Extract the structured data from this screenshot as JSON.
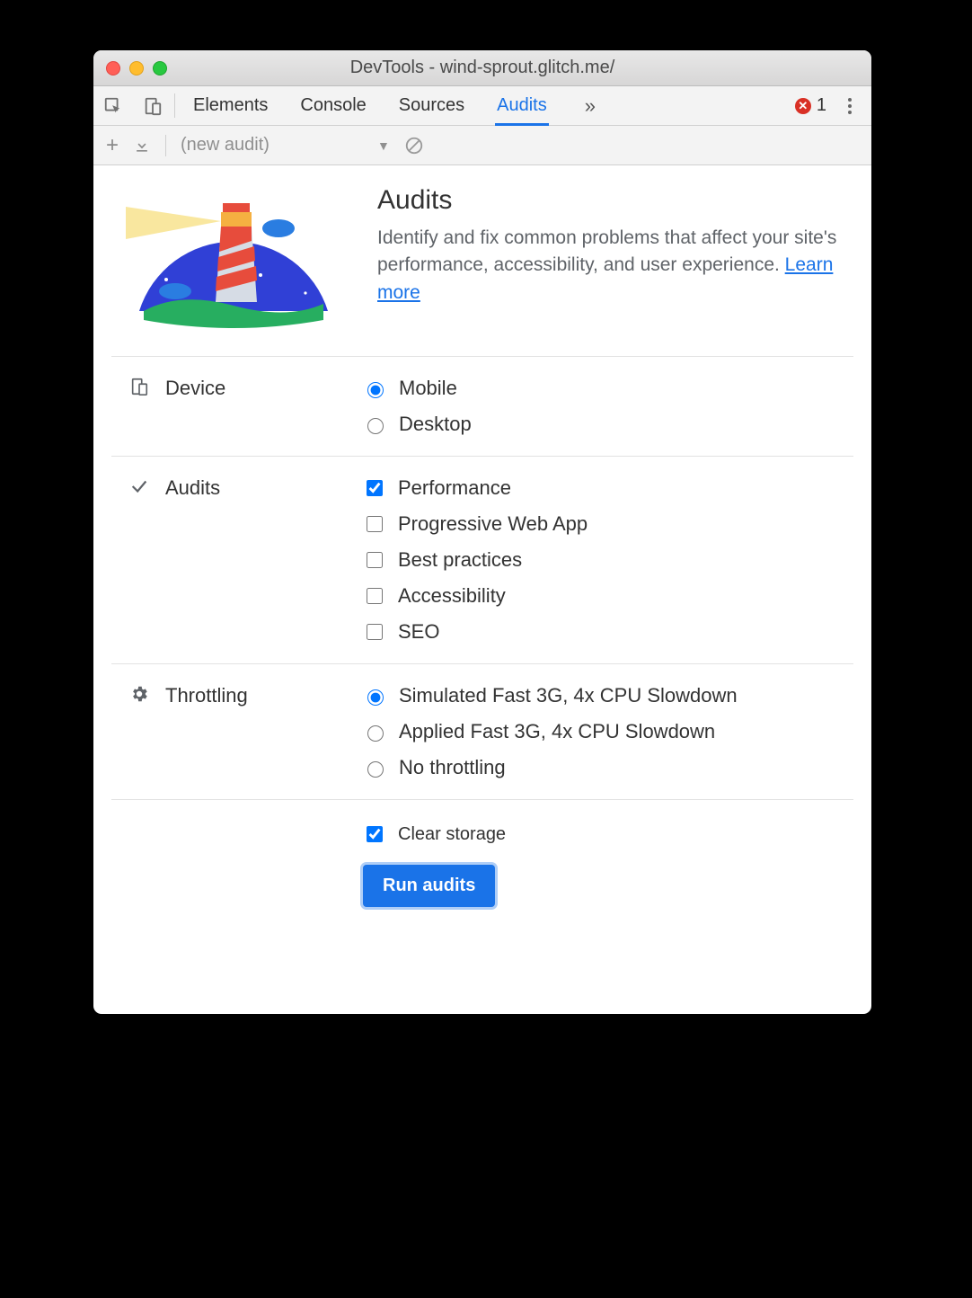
{
  "window": {
    "title": "DevTools - wind-sprout.glitch.me/"
  },
  "tabs": {
    "items": [
      "Elements",
      "Console",
      "Sources",
      "Audits"
    ],
    "active": 3,
    "error_count": "1"
  },
  "toolbar": {
    "select_label": "(new audit)"
  },
  "hero": {
    "heading": "Audits",
    "description": "Identify and fix common problems that affect your site's performance, accessibility, and user experience. ",
    "learn_more": "Learn more"
  },
  "sections": {
    "device": {
      "label": "Device",
      "options": [
        {
          "label": "Mobile",
          "checked": true
        },
        {
          "label": "Desktop",
          "checked": false
        }
      ]
    },
    "audits": {
      "label": "Audits",
      "options": [
        {
          "label": "Performance",
          "checked": true
        },
        {
          "label": "Progressive Web App",
          "checked": false
        },
        {
          "label": "Best practices",
          "checked": false
        },
        {
          "label": "Accessibility",
          "checked": false
        },
        {
          "label": "SEO",
          "checked": false
        }
      ]
    },
    "throttling": {
      "label": "Throttling",
      "options": [
        {
          "label": "Simulated Fast 3G, 4x CPU Slowdown",
          "checked": true
        },
        {
          "label": "Applied Fast 3G, 4x CPU Slowdown",
          "checked": false
        },
        {
          "label": "No throttling",
          "checked": false
        }
      ]
    },
    "clear_storage": {
      "label": "Clear storage",
      "checked": true
    }
  },
  "run_button": "Run audits"
}
